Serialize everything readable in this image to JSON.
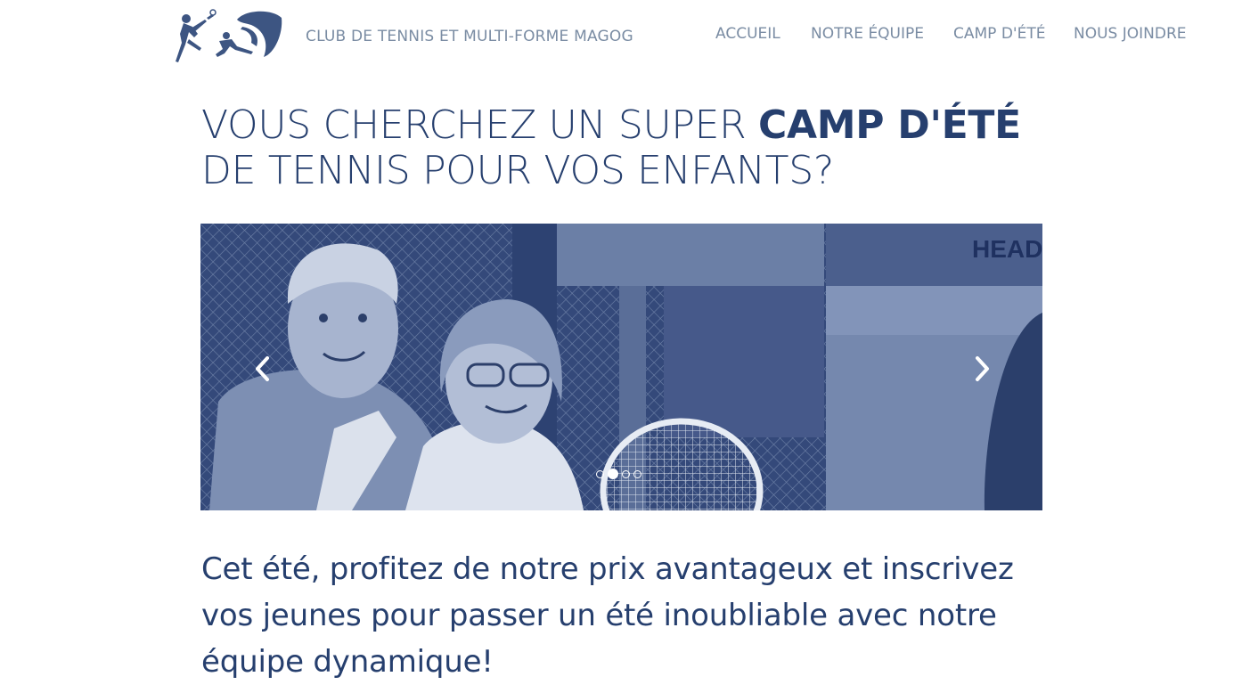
{
  "header": {
    "brand": "CLUB DE TENNIS ET MULTI-FORME MAGOG",
    "logo_icon": "tennis-players-logo-icon",
    "nav": [
      {
        "label": "ACCUEIL"
      },
      {
        "label": "NOTRE ÉQUIPE"
      },
      {
        "label": "CAMP D'ÉTÉ"
      },
      {
        "label": "NOUS JOINDRE"
      }
    ]
  },
  "hero": {
    "line1_a": "VOUS CHERCHEZ UN SUPER ",
    "line1_b": "CAMP D'ÉTÉ",
    "line2": "DE TENNIS POUR VOS ENFANTS?"
  },
  "carousel": {
    "prev_icon": "chevron-left-icon",
    "next_icon": "chevron-right-icon",
    "slide_count": 4,
    "active_index": 1,
    "tint": "#3f5683",
    "sign_text": "HEAD"
  },
  "lead": "Cet été, profitez de notre prix avantageux et inscrivez vos jeunes pour passer un été inoubliable avec notre équipe dynamique!",
  "colors": {
    "heading": "#263f6e",
    "nav": "#7a8ca3"
  }
}
